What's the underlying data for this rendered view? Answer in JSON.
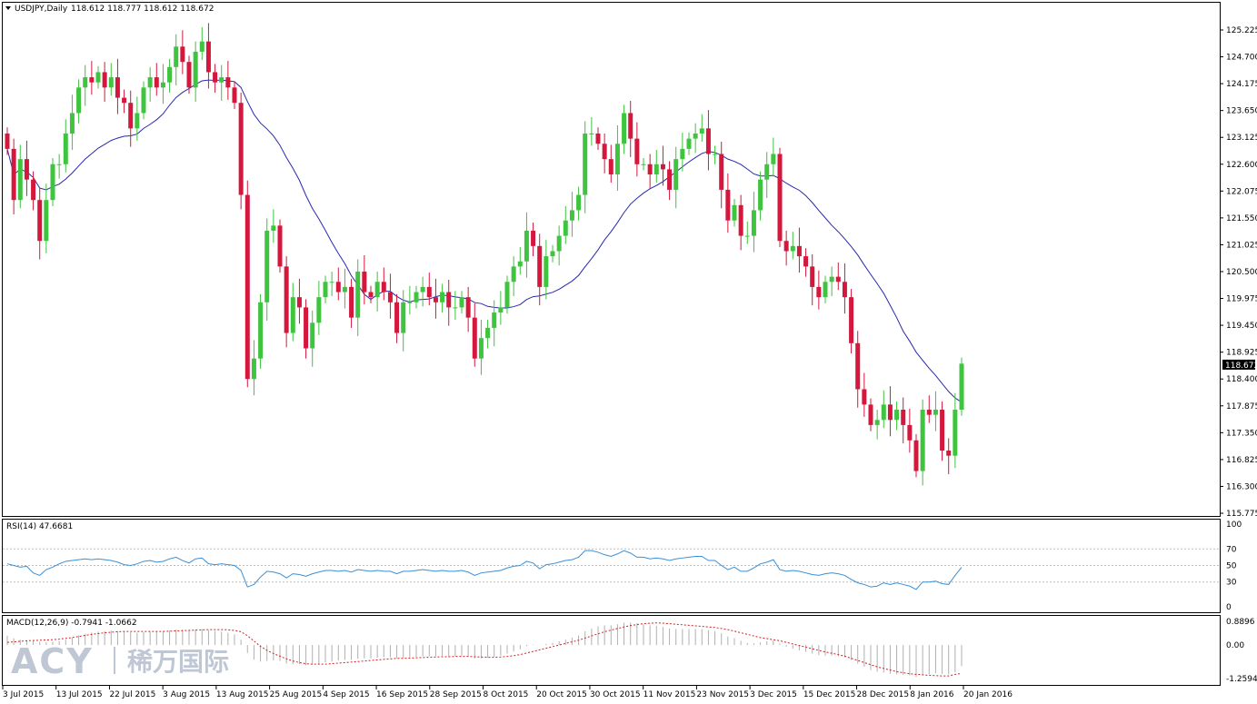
{
  "chart_data": {
    "type": "candlestick",
    "symbol_header": "USDJPY,Daily",
    "ohlc_header": "118.612 118.777 118.612 118.672",
    "price_axis": {
      "ticks": [
        "125.225",
        "124.700",
        "124.175",
        "123.650",
        "123.125",
        "122.600",
        "122.075",
        "121.550",
        "121.025",
        "120.500",
        "119.975",
        "119.450",
        "118.925",
        "118.400",
        "117.875",
        "117.350",
        "116.825",
        "116.300",
        "115.775"
      ],
      "ylim": [
        115.775,
        125.225
      ]
    },
    "current_price": "118.672",
    "date_labels": [
      "3 Jul 2015",
      "13 Jul 2015",
      "22 Jul 2015",
      "3 Aug 2015",
      "13 Aug 2015",
      "25 Aug 2015",
      "4 Sep 2015",
      "16 Sep 2015",
      "28 Sep 2015",
      "8 Oct 2015",
      "20 Oct 2015",
      "30 Oct 2015",
      "11 Nov 2015",
      "23 Nov 2015",
      "3 Dec 2015",
      "15 Dec 2015",
      "28 Dec 2015",
      "8 Jan 2016",
      "20 Jan 2016"
    ],
    "colors": {
      "bull": "#3ec43e",
      "bear": "#d4173c",
      "ma": "#2828b0",
      "rsi": "#3a8fd6",
      "macd_signal": "#d42020",
      "macd_hist": "#b0b0b0"
    },
    "candles_close": [
      122.9,
      121.9,
      122.7,
      122.3,
      121.9,
      121.1,
      121.9,
      122.6,
      122.6,
      123.2,
      123.6,
      124.1,
      124.3,
      124.2,
      124.4,
      124.1,
      124.3,
      123.9,
      123.8,
      123.3,
      123.6,
      124.1,
      124.3,
      124.1,
      124.2,
      124.5,
      124.9,
      124.6,
      124.1,
      124.8,
      125.0,
      124.4,
      124.2,
      124.3,
      124.1,
      123.8,
      122.0,
      118.4,
      118.8,
      119.9,
      121.3,
      121.4,
      120.6,
      119.3,
      120.0,
      119.8,
      119.0,
      119.5,
      120.0,
      120.3,
      120.3,
      120.1,
      120.2,
      119.6,
      120.5,
      120.1,
      120.0,
      120.3,
      120.1,
      119.9,
      119.3,
      119.9,
      119.9,
      120.1,
      120.2,
      120.0,
      119.9,
      120.1,
      119.8,
      119.8,
      120.0,
      119.6,
      118.8,
      119.2,
      119.4,
      119.7,
      119.8,
      120.3,
      120.6,
      120.7,
      121.3,
      121.0,
      120.2,
      120.8,
      120.9,
      121.2,
      121.5,
      121.7,
      122.0,
      123.2,
      123.2,
      123.0,
      122.7,
      122.4,
      123.0,
      123.6,
      123.1,
      122.6,
      122.6,
      122.4,
      122.6,
      122.5,
      122.1,
      122.7,
      122.9,
      123.1,
      123.2,
      123.3,
      122.8,
      122.8,
      122.1,
      121.5,
      121.8,
      121.2,
      121.2,
      121.7,
      122.3,
      122.6,
      122.8,
      121.1,
      120.9,
      121.0,
      120.8,
      120.6,
      120.2,
      120.0,
      120.3,
      120.4,
      120.3,
      120.0,
      119.1,
      118.2,
      117.9,
      117.5,
      117.6,
      117.9,
      117.6,
      117.8,
      117.5,
      117.2,
      116.6,
      117.8,
      117.7,
      117.8,
      117.0,
      116.9,
      117.8,
      118.7
    ]
  },
  "indicators": {
    "rsi": {
      "header": "RSI(14) 47.6681",
      "ticks": [
        "100",
        "70",
        "50",
        "30",
        "0"
      ],
      "values": [
        52,
        50,
        48,
        49,
        41,
        38,
        45,
        48,
        52,
        55,
        56,
        57,
        58,
        57,
        58,
        57,
        56,
        54,
        51,
        50,
        52,
        55,
        56,
        54,
        55,
        58,
        60,
        56,
        53,
        58,
        59,
        52,
        51,
        52,
        51,
        50,
        44,
        24,
        27,
        36,
        43,
        42,
        40,
        35,
        40,
        39,
        37,
        40,
        42,
        44,
        44,
        43,
        44,
        42,
        45,
        44,
        43,
        44,
        43,
        43,
        40,
        43,
        43,
        44,
        45,
        44,
        43,
        44,
        43,
        43,
        44,
        42,
        38,
        41,
        42,
        43,
        44,
        47,
        49,
        50,
        55,
        53,
        46,
        51,
        52,
        54,
        56,
        57,
        60,
        68,
        68,
        66,
        63,
        61,
        64,
        68,
        65,
        60,
        60,
        58,
        59,
        58,
        56,
        58,
        59,
        60,
        61,
        61,
        56,
        56,
        50,
        45,
        48,
        43,
        43,
        47,
        52,
        54,
        57,
        45,
        43,
        44,
        43,
        41,
        39,
        38,
        40,
        41,
        40,
        38,
        33,
        29,
        27,
        24,
        25,
        29,
        27,
        29,
        27,
        25,
        21,
        30,
        30,
        31,
        28,
        27,
        38,
        47.7
      ]
    },
    "macd": {
      "header": "MACD(12,26,9) -0.7941 -1.0662",
      "ticks": [
        "0.8896",
        "0.00",
        "-1.2594"
      ],
      "values": [
        0.35,
        0.25,
        0.2,
        0.18,
        0.15,
        0.12,
        0.1,
        0.12,
        0.15,
        0.2,
        0.28,
        0.36,
        0.42,
        0.47,
        0.5,
        0.52,
        0.54,
        0.52,
        0.5,
        0.48,
        0.46,
        0.48,
        0.5,
        0.5,
        0.51,
        0.54,
        0.58,
        0.58,
        0.56,
        0.58,
        0.6,
        0.56,
        0.52,
        0.5,
        0.46,
        0.4,
        0.2,
        -0.3,
        -0.55,
        -0.62,
        -0.6,
        -0.58,
        -0.6,
        -0.7,
        -0.72,
        -0.72,
        -0.76,
        -0.74,
        -0.7,
        -0.66,
        -0.62,
        -0.58,
        -0.56,
        -0.56,
        -0.52,
        -0.5,
        -0.5,
        -0.48,
        -0.46,
        -0.46,
        -0.5,
        -0.48,
        -0.46,
        -0.44,
        -0.42,
        -0.42,
        -0.42,
        -0.4,
        -0.42,
        -0.42,
        -0.4,
        -0.42,
        -0.5,
        -0.5,
        -0.48,
        -0.44,
        -0.4,
        -0.32,
        -0.24,
        -0.16,
        -0.04,
        0.02,
        0.0,
        0.04,
        0.08,
        0.14,
        0.2,
        0.28,
        0.36,
        0.52,
        0.62,
        0.7,
        0.74,
        0.74,
        0.78,
        0.84,
        0.84,
        0.82,
        0.78,
        0.74,
        0.72,
        0.68,
        0.62,
        0.6,
        0.6,
        0.6,
        0.6,
        0.6,
        0.56,
        0.52,
        0.44,
        0.32,
        0.26,
        0.16,
        0.08,
        0.06,
        0.1,
        0.14,
        0.18,
        0.06,
        -0.06,
        -0.14,
        -0.2,
        -0.26,
        -0.32,
        -0.38,
        -0.4,
        -0.4,
        -0.42,
        -0.46,
        -0.56,
        -0.7,
        -0.82,
        -0.94,
        -1.0,
        -1.04,
        -1.08,
        -1.1,
        -1.12,
        -1.14,
        -1.2,
        -1.14,
        -1.1,
        -1.06,
        -1.08,
        -1.1,
        -1.02,
        -0.79
      ],
      "signal": [
        0.1,
        0.12,
        0.14,
        0.16,
        0.17,
        0.18,
        0.19,
        0.2,
        0.22,
        0.25,
        0.28,
        0.32,
        0.36,
        0.4,
        0.43,
        0.46,
        0.48,
        0.5,
        0.51,
        0.51,
        0.51,
        0.51,
        0.51,
        0.51,
        0.51,
        0.52,
        0.53,
        0.54,
        0.55,
        0.56,
        0.57,
        0.58,
        0.58,
        0.58,
        0.57,
        0.55,
        0.5,
        0.35,
        0.15,
        -0.05,
        -0.2,
        -0.32,
        -0.42,
        -0.52,
        -0.6,
        -0.66,
        -0.7,
        -0.72,
        -0.72,
        -0.72,
        -0.7,
        -0.68,
        -0.66,
        -0.64,
        -0.62,
        -0.6,
        -0.58,
        -0.56,
        -0.54,
        -0.52,
        -0.5,
        -0.5,
        -0.49,
        -0.48,
        -0.47,
        -0.46,
        -0.45,
        -0.44,
        -0.44,
        -0.43,
        -0.43,
        -0.43,
        -0.44,
        -0.45,
        -0.46,
        -0.46,
        -0.45,
        -0.43,
        -0.4,
        -0.36,
        -0.3,
        -0.24,
        -0.18,
        -0.12,
        -0.06,
        0.0,
        0.06,
        0.12,
        0.18,
        0.26,
        0.34,
        0.42,
        0.5,
        0.56,
        0.62,
        0.68,
        0.73,
        0.77,
        0.8,
        0.82,
        0.83,
        0.82,
        0.8,
        0.78,
        0.76,
        0.74,
        0.72,
        0.7,
        0.68,
        0.66,
        0.62,
        0.58,
        0.52,
        0.46,
        0.4,
        0.34,
        0.28,
        0.24,
        0.2,
        0.16,
        0.1,
        0.04,
        -0.02,
        -0.08,
        -0.14,
        -0.2,
        -0.26,
        -0.31,
        -0.36,
        -0.42,
        -0.5,
        -0.58,
        -0.66,
        -0.74,
        -0.82,
        -0.88,
        -0.94,
        -1.0,
        -1.04,
        -1.08,
        -1.1,
        -1.12,
        -1.14,
        -1.15,
        -1.16,
        -1.16,
        -1.1,
        -1.07
      ]
    }
  },
  "watermark": {
    "brand": "ACY",
    "cn": "稀万国际"
  }
}
